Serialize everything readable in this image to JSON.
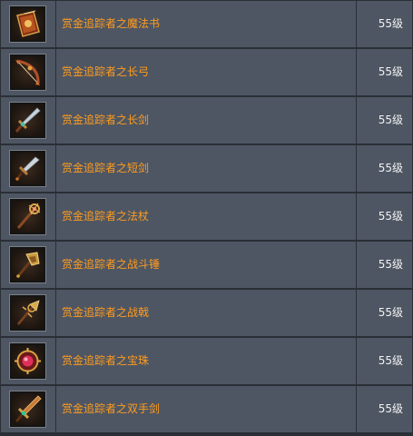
{
  "rows": [
    {
      "icon": "spellbook-icon",
      "name": "赏金追踪者之魔法书",
      "level": "55级"
    },
    {
      "icon": "longbow-icon",
      "name": "赏金追踪者之长弓",
      "level": "55级"
    },
    {
      "icon": "longsword-icon",
      "name": "赏金追踪者之长剑",
      "level": "55级"
    },
    {
      "icon": "shortsword-icon",
      "name": "赏金追踪者之短剑",
      "level": "55级"
    },
    {
      "icon": "staff-icon",
      "name": "赏金追踪者之法杖",
      "level": "55级"
    },
    {
      "icon": "warhammer-icon",
      "name": "赏金追踪者之战斗锤",
      "level": "55级"
    },
    {
      "icon": "halberd-icon",
      "name": "赏金追踪者之战戟",
      "level": "55级"
    },
    {
      "icon": "orb-icon",
      "name": "赏金追踪者之宝珠",
      "level": "55级"
    },
    {
      "icon": "greatsword-icon",
      "name": "赏金追踪者之双手剑",
      "level": "55级"
    }
  ],
  "colors": {
    "name_text": "#ff9c1f",
    "level_text": "#f2f2f2",
    "cell_bg": "#4e5663",
    "grid": "#2a2f36"
  }
}
